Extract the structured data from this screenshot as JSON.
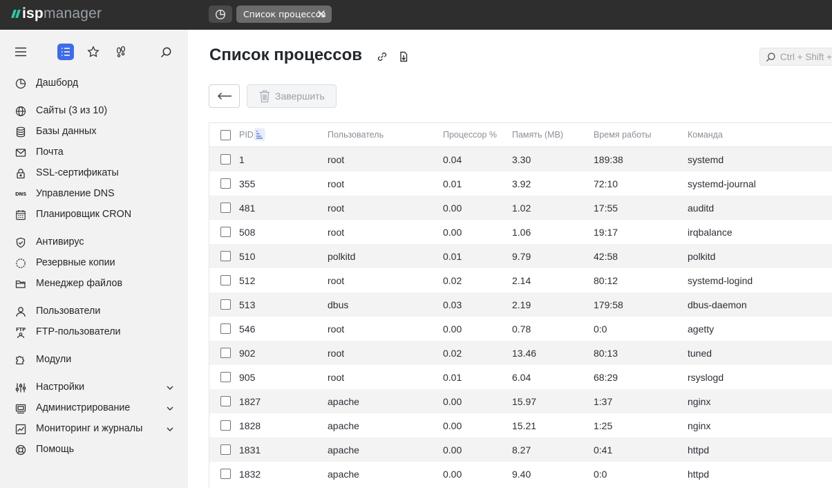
{
  "app": {
    "logo_isp": "isp",
    "logo_manager": "manager"
  },
  "tabs": {
    "active_label": "Список процессов"
  },
  "sidebar": {
    "items": [
      {
        "label": "Дашборд",
        "icon": "dashboard-icon"
      },
      {
        "label": "Сайты (3 из 10)",
        "icon": "globe-icon"
      },
      {
        "label": "Базы данных",
        "icon": "database-icon"
      },
      {
        "label": "Почта",
        "icon": "mail-icon"
      },
      {
        "label": "SSL-сертификаты",
        "icon": "lock-icon"
      },
      {
        "label": "Управление DNS",
        "icon": "dns-icon",
        "badge": "DNS"
      },
      {
        "label": "Планировщик CRON",
        "icon": "calendar-icon"
      },
      {
        "label": "Антивирус",
        "icon": "shield-check-icon"
      },
      {
        "label": "Резервные копии",
        "icon": "backup-icon"
      },
      {
        "label": "Менеджер файлов",
        "icon": "folder-icon"
      },
      {
        "label": "Пользователи",
        "icon": "user-icon"
      },
      {
        "label": "FTP-пользователи",
        "icon": "ftp-user-icon",
        "badge": "FTP"
      },
      {
        "label": "Модули",
        "icon": "puzzle-icon"
      },
      {
        "label": "Настройки",
        "icon": "sliders-icon"
      },
      {
        "label": "Администрирование",
        "icon": "server-icon"
      },
      {
        "label": "Мониторинг и журналы",
        "icon": "chart-icon"
      },
      {
        "label": "Помощь",
        "icon": "help-icon"
      }
    ]
  },
  "main": {
    "title": "Список процессов",
    "search_placeholder": "Ctrl + Shift +",
    "kill_button": "Завершить",
    "columns": [
      "PID",
      "Пользователь",
      "Процессор %",
      "Память (MB)",
      "Время работы",
      "Команда"
    ],
    "rows": [
      {
        "pid": "1",
        "user": "root",
        "cpu": "0.04",
        "mem": "3.30",
        "time": "189:38",
        "cmd": "systemd"
      },
      {
        "pid": "355",
        "user": "root",
        "cpu": "0.01",
        "mem": "3.92",
        "time": "72:10",
        "cmd": "systemd-journal"
      },
      {
        "pid": "481",
        "user": "root",
        "cpu": "0.00",
        "mem": "1.02",
        "time": "17:55",
        "cmd": "auditd"
      },
      {
        "pid": "508",
        "user": "root",
        "cpu": "0.00",
        "mem": "1.06",
        "time": "19:17",
        "cmd": "irqbalance"
      },
      {
        "pid": "510",
        "user": "polkitd",
        "cpu": "0.01",
        "mem": "9.79",
        "time": "42:58",
        "cmd": "polkitd"
      },
      {
        "pid": "512",
        "user": "root",
        "cpu": "0.02",
        "mem": "2.14",
        "time": "80:12",
        "cmd": "systemd-logind"
      },
      {
        "pid": "513",
        "user": "dbus",
        "cpu": "0.03",
        "mem": "2.19",
        "time": "179:58",
        "cmd": "dbus-daemon"
      },
      {
        "pid": "546",
        "user": "root",
        "cpu": "0.00",
        "mem": "0.78",
        "time": "0:0",
        "cmd": "agetty"
      },
      {
        "pid": "902",
        "user": "root",
        "cpu": "0.02",
        "mem": "13.46",
        "time": "80:13",
        "cmd": "tuned"
      },
      {
        "pid": "905",
        "user": "root",
        "cpu": "0.01",
        "mem": "6.04",
        "time": "68:29",
        "cmd": "rsyslogd"
      },
      {
        "pid": "1827",
        "user": "apache",
        "cpu": "0.00",
        "mem": "15.97",
        "time": "1:37",
        "cmd": "nginx"
      },
      {
        "pid": "1828",
        "user": "apache",
        "cpu": "0.00",
        "mem": "15.21",
        "time": "1:25",
        "cmd": "nginx"
      },
      {
        "pid": "1831",
        "user": "apache",
        "cpu": "0.00",
        "mem": "8.27",
        "time": "0:41",
        "cmd": "httpd"
      },
      {
        "pid": "1832",
        "user": "apache",
        "cpu": "0.00",
        "mem": "9.40",
        "time": "0:0",
        "cmd": "httpd"
      }
    ]
  },
  "colors": {
    "topbar": "#2e2e2e",
    "accent": "#3f6ce6",
    "logo_mark": "#2ec7a3",
    "sidebar_bg": "#f2f2f2"
  }
}
